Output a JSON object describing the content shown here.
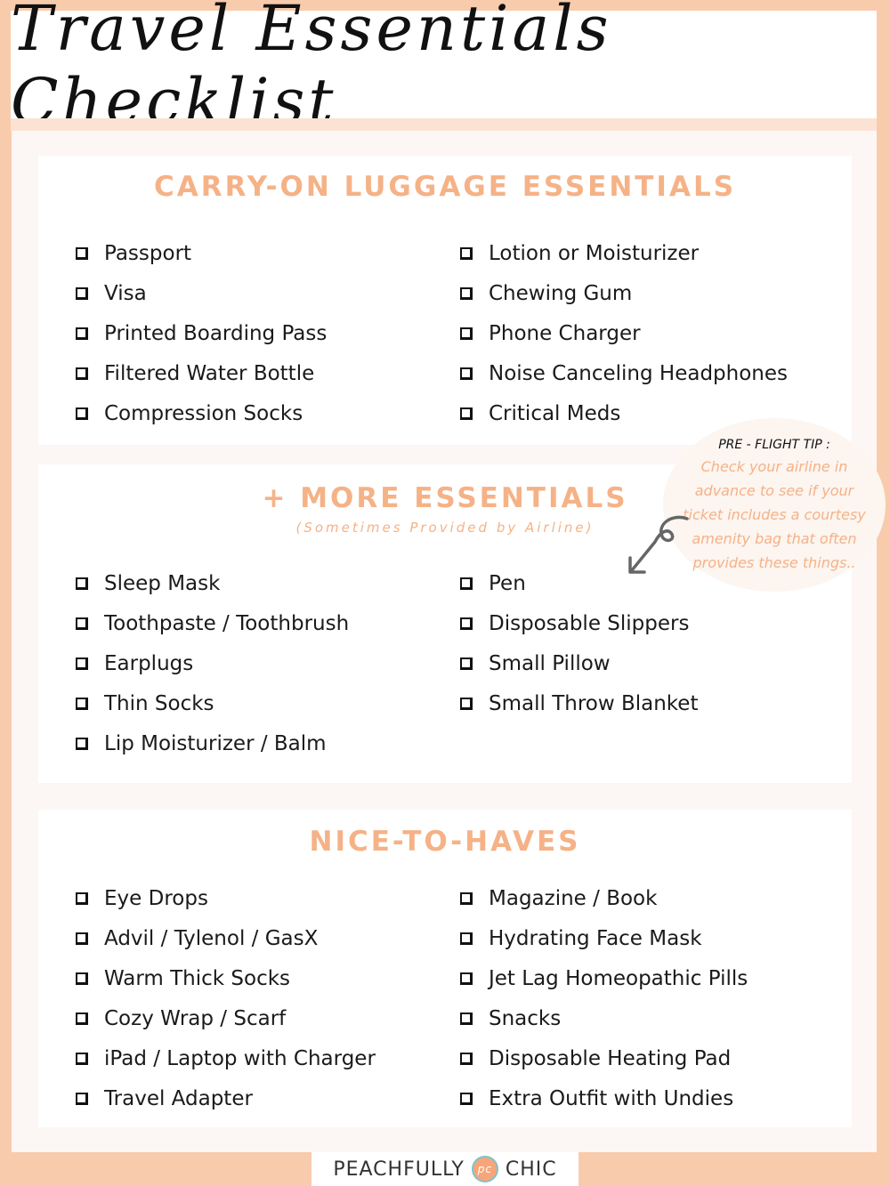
{
  "title": "Travel Essentials Checklist",
  "colors": {
    "accent": "#f5b287",
    "border": "#f8cbad",
    "background": "#fcf7f4",
    "text": "#1a1a1a"
  },
  "sections": [
    {
      "heading": "CARRY-ON LUGGAGE ESSENTIALS",
      "left": [
        "Passport",
        "Visa",
        "Printed Boarding Pass",
        "Filtered Water Bottle",
        "Compression Socks"
      ],
      "right": [
        "Lotion or Moisturizer",
        "Chewing Gum",
        "Phone Charger",
        "Noise Canceling Headphones",
        "Critical Meds"
      ]
    },
    {
      "heading": "+ MORE ESSENTIALS",
      "subheading": "(Sometimes Provided by Airline)",
      "left": [
        "Sleep Mask",
        "Toothpaste / Toothbrush",
        "Earplugs",
        "Thin Socks",
        "Lip Moisturizer / Balm"
      ],
      "right": [
        "Pen",
        "Disposable Slippers",
        "Small Pillow",
        "Small Throw Blanket"
      ]
    },
    {
      "heading": "NICE-TO-HAVES",
      "left": [
        "Eye Drops",
        "Advil / Tylenol / GasX",
        "Warm Thick Socks",
        "Cozy Wrap / Scarf",
        "iPad / Laptop with Charger",
        "Travel Adapter"
      ],
      "right": [
        "Magazine / Book",
        "Hydrating Face Mask",
        "Jet Lag Homeopathic Pills",
        "Snacks",
        "Disposable Heating Pad",
        "Extra Outfit with Undies"
      ]
    }
  ],
  "tip": {
    "heading": "PRE - FLIGHT TIP :",
    "body": "Check your airline in advance to see if your ticket includes a courtesy amenity bag that often provides these things.."
  },
  "footer": {
    "brand_left": "PEACHFULLY",
    "logo_text": "pc",
    "brand_right": "CHIC"
  },
  "icons": {
    "checkbox": "checkbox-icon",
    "arrow": "curly-arrow-icon",
    "logo": "peach-logo-icon"
  }
}
